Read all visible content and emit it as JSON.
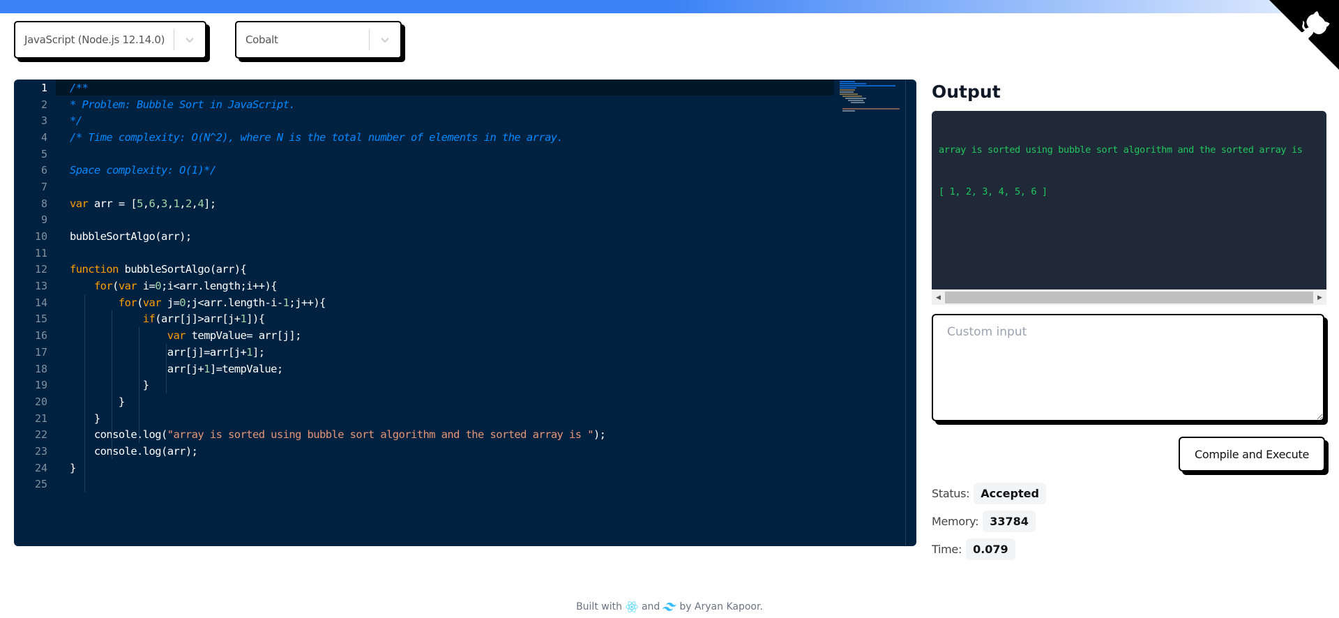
{
  "language_select": {
    "value": "JavaScript (Node.js 12.14.0)"
  },
  "theme_select": {
    "value": "Cobalt"
  },
  "icons": {
    "github": "github-corner-icon",
    "chevron": "chevron-down-icon",
    "react": "react-icon",
    "tailwind": "tailwind-icon"
  },
  "editor": {
    "active_line": 1,
    "lines": [
      {
        "n": "1",
        "tokens": [
          {
            "t": "cmt",
            "v": "/**"
          }
        ]
      },
      {
        "n": "2",
        "tokens": [
          {
            "t": "cmt",
            "v": "* Problem: Bubble Sort in JavaScript."
          }
        ]
      },
      {
        "n": "3",
        "tokens": [
          {
            "t": "cmt",
            "v": "*/"
          }
        ]
      },
      {
        "n": "4",
        "tokens": [
          {
            "t": "cmt",
            "v": "/* Time complexity: O(N^2), where N is the total number of elements in the array."
          }
        ]
      },
      {
        "n": "5",
        "tokens": []
      },
      {
        "n": "6",
        "tokens": [
          {
            "t": "cmt",
            "v": "Space complexity: O(1)*/"
          }
        ]
      },
      {
        "n": "7",
        "tokens": []
      },
      {
        "n": "8",
        "tokens": [
          {
            "t": "kw",
            "v": "var"
          },
          {
            "t": "plain",
            "v": " arr = ["
          },
          {
            "t": "num",
            "v": "5"
          },
          {
            "t": "plain",
            "v": ","
          },
          {
            "t": "num",
            "v": "6"
          },
          {
            "t": "plain",
            "v": ","
          },
          {
            "t": "num",
            "v": "3"
          },
          {
            "t": "plain",
            "v": ","
          },
          {
            "t": "num",
            "v": "1"
          },
          {
            "t": "plain",
            "v": ","
          },
          {
            "t": "num",
            "v": "2"
          },
          {
            "t": "plain",
            "v": ","
          },
          {
            "t": "num",
            "v": "4"
          },
          {
            "t": "plain",
            "v": "];"
          }
        ]
      },
      {
        "n": "9",
        "tokens": []
      },
      {
        "n": "10",
        "tokens": [
          {
            "t": "plain",
            "v": "bubbleSortAlgo(arr);"
          }
        ]
      },
      {
        "n": "11",
        "tokens": []
      },
      {
        "n": "12",
        "tokens": [
          {
            "t": "kw",
            "v": "function"
          },
          {
            "t": "plain",
            "v": " bubbleSortAlgo(arr){"
          }
        ]
      },
      {
        "n": "13",
        "tokens": [
          {
            "t": "plain",
            "v": "    "
          },
          {
            "t": "kw",
            "v": "for"
          },
          {
            "t": "plain",
            "v": "("
          },
          {
            "t": "kw",
            "v": "var"
          },
          {
            "t": "plain",
            "v": " i="
          },
          {
            "t": "num",
            "v": "0"
          },
          {
            "t": "plain",
            "v": ";i<arr.length;i++){"
          }
        ]
      },
      {
        "n": "14",
        "tokens": [
          {
            "t": "plain",
            "v": "        "
          },
          {
            "t": "kw",
            "v": "for"
          },
          {
            "t": "plain",
            "v": "("
          },
          {
            "t": "kw",
            "v": "var"
          },
          {
            "t": "plain",
            "v": " j="
          },
          {
            "t": "num",
            "v": "0"
          },
          {
            "t": "plain",
            "v": ";j<arr.length-i-"
          },
          {
            "t": "num",
            "v": "1"
          },
          {
            "t": "plain",
            "v": ";j++){"
          }
        ]
      },
      {
        "n": "15",
        "tokens": [
          {
            "t": "plain",
            "v": "            "
          },
          {
            "t": "kw",
            "v": "if"
          },
          {
            "t": "plain",
            "v": "(arr[j]>arr[j+"
          },
          {
            "t": "num",
            "v": "1"
          },
          {
            "t": "plain",
            "v": "]){"
          }
        ]
      },
      {
        "n": "16",
        "tokens": [
          {
            "t": "plain",
            "v": "                "
          },
          {
            "t": "kw",
            "v": "var"
          },
          {
            "t": "plain",
            "v": " tempValue= arr[j];"
          }
        ]
      },
      {
        "n": "17",
        "tokens": [
          {
            "t": "plain",
            "v": "                arr[j]=arr[j+"
          },
          {
            "t": "num",
            "v": "1"
          },
          {
            "t": "plain",
            "v": "];"
          }
        ]
      },
      {
        "n": "18",
        "tokens": [
          {
            "t": "plain",
            "v": "                arr[j+"
          },
          {
            "t": "num",
            "v": "1"
          },
          {
            "t": "plain",
            "v": "]=tempValue;"
          }
        ]
      },
      {
        "n": "19",
        "tokens": [
          {
            "t": "plain",
            "v": "            }"
          }
        ]
      },
      {
        "n": "20",
        "tokens": [
          {
            "t": "plain",
            "v": "        }"
          }
        ]
      },
      {
        "n": "21",
        "tokens": [
          {
            "t": "plain",
            "v": "    }"
          }
        ]
      },
      {
        "n": "22",
        "tokens": [
          {
            "t": "plain",
            "v": "    console.log("
          },
          {
            "t": "str",
            "v": "\"array is sorted using bubble sort algorithm and the sorted array is \""
          },
          {
            "t": "plain",
            "v": ");"
          }
        ]
      },
      {
        "n": "23",
        "tokens": [
          {
            "t": "plain",
            "v": "    console.log(arr);"
          }
        ]
      },
      {
        "n": "24",
        "tokens": [
          {
            "t": "plain",
            "v": "}"
          }
        ]
      },
      {
        "n": "25",
        "tokens": []
      }
    ]
  },
  "output": {
    "title": "Output",
    "lines": [
      "array is sorted using bubble sort algorithm and the sorted array is",
      "[ 1, 2, 3, 4, 5, 6 ]"
    ]
  },
  "custom_input": {
    "placeholder": "Custom input",
    "value": ""
  },
  "compile_button": {
    "label": "Compile and Execute"
  },
  "stats": {
    "status": {
      "label": "Status:",
      "value": "Accepted"
    },
    "memory": {
      "label": "Memory:",
      "value": "33784"
    },
    "time": {
      "label": "Time:",
      "value": "0.079"
    }
  },
  "footer": {
    "built_with": "Built with",
    "and": "and",
    "by": "by Aryan Kapoor."
  },
  "colors": {
    "accent": "#3b82f6",
    "editor_bg": "#002240",
    "output_bg": "#1f2937",
    "output_text": "#22c55e",
    "comment": "#0088ff",
    "keyword": "#ff9d00",
    "string": "#e59577"
  }
}
